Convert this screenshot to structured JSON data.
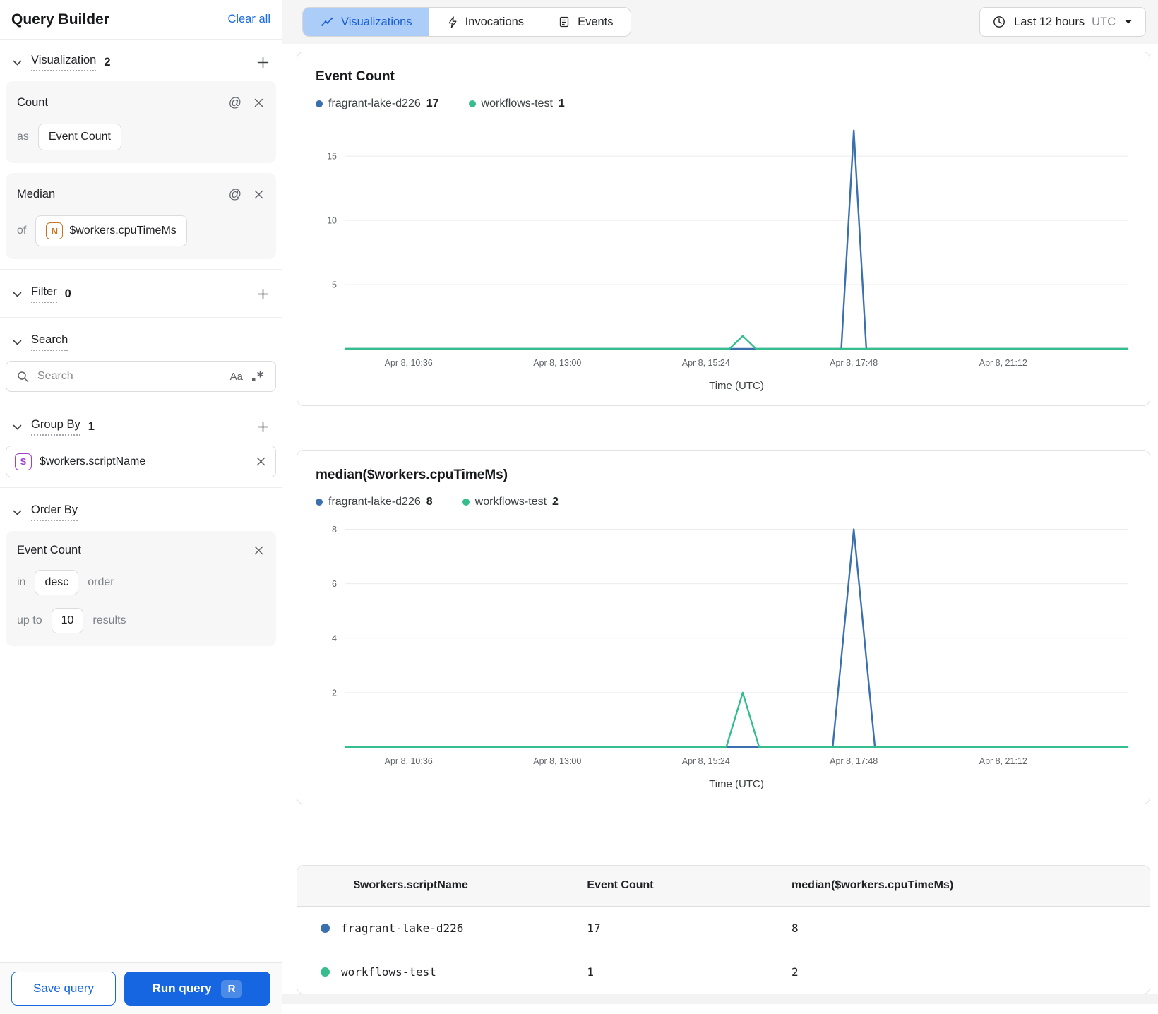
{
  "colors": {
    "accent_blue": "#1566e0",
    "link_blue": "#1a6ce0",
    "series_blue": "#3b70af",
    "series_green": "#35bd8d",
    "tab_selected_bg": "#abcdf8",
    "tab_selected_fg": "#1a5fd0"
  },
  "sidebar": {
    "title": "Query Builder",
    "clear_all_label": "Clear all",
    "visualization": {
      "label": "Visualization",
      "count": "2",
      "cards": [
        {
          "title": "Count",
          "prefix": "as",
          "value": "Event Count"
        },
        {
          "title": "Median",
          "prefix": "of",
          "field_badge": "N",
          "value": "$workers.cpuTimeMs"
        }
      ]
    },
    "filter": {
      "label": "Filter",
      "count": "0"
    },
    "search": {
      "label": "Search",
      "placeholder": "Search",
      "case_toggle": "Aa"
    },
    "group_by": {
      "label": "Group By",
      "count": "1",
      "items": [
        {
          "badge": "S",
          "value": "$workers.scriptName"
        }
      ]
    },
    "order_by": {
      "label": "Order By",
      "card": {
        "title": "Event Count",
        "in_label": "in",
        "direction": "desc",
        "order_label": "order",
        "up_to_label": "up to",
        "limit": "10",
        "results_label": "results"
      }
    },
    "footer": {
      "save_label": "Save query",
      "run_label": "Run query",
      "run_shortcut": "R"
    }
  },
  "topbar": {
    "tabs": [
      {
        "label": "Visualizations",
        "icon": "chart-line-icon",
        "selected": true
      },
      {
        "label": "Invocations",
        "icon": "bolt-icon",
        "selected": false
      },
      {
        "label": "Events",
        "icon": "events-icon",
        "selected": false
      }
    ],
    "time_range": {
      "label": "Last 12 hours",
      "timezone": "UTC"
    }
  },
  "chart_data": [
    {
      "type": "line",
      "title": "Event Count",
      "xlabel": "Time (UTC)",
      "x_ticks": [
        "Apr 8, 10:36",
        "Apr 8, 13:00",
        "Apr 8, 15:24",
        "Apr 8, 17:48",
        "Apr 8, 21:12"
      ],
      "x_tick_fracs": [
        0.081,
        0.271,
        0.461,
        0.65,
        0.841
      ],
      "y_ticks": [
        5,
        10,
        15
      ],
      "ylim": [
        0,
        17.7
      ],
      "grid": true,
      "legend_position": "top",
      "legend": [
        {
          "name": "fragrant-lake-d226",
          "value": "17",
          "color": "#3b70af"
        },
        {
          "name": "workflows-test",
          "value": "1",
          "color": "#35bd8d"
        }
      ],
      "series": [
        {
          "name": "fragrant-lake-d226",
          "color": "#3b70af",
          "points": [
            [
              0,
              0
            ],
            [
              0.634,
              0
            ],
            [
              0.65,
              17
            ],
            [
              0.666,
              0
            ],
            [
              1,
              0
            ]
          ]
        },
        {
          "name": "workflows-test",
          "color": "#35bd8d",
          "points": [
            [
              0,
              0
            ],
            [
              0.491,
              0
            ],
            [
              0.508,
              1
            ],
            [
              0.525,
              0
            ],
            [
              1,
              0
            ]
          ]
        }
      ]
    },
    {
      "type": "line",
      "title": "median($workers.cpuTimeMs)",
      "xlabel": "Time (UTC)",
      "x_ticks": [
        "Apr 8, 10:36",
        "Apr 8, 13:00",
        "Apr 8, 15:24",
        "Apr 8, 17:48",
        "Apr 8, 21:12"
      ],
      "x_tick_fracs": [
        0.081,
        0.271,
        0.461,
        0.65,
        0.841
      ],
      "y_ticks": [
        2,
        4,
        6,
        8
      ],
      "ylim": [
        0,
        8.35
      ],
      "grid": true,
      "legend_position": "top",
      "legend": [
        {
          "name": "fragrant-lake-d226",
          "value": "8",
          "color": "#3b70af"
        },
        {
          "name": "workflows-test",
          "value": "2",
          "color": "#35bd8d"
        }
      ],
      "series": [
        {
          "name": "fragrant-lake-d226",
          "color": "#3b70af",
          "points": [
            [
              0,
              0
            ],
            [
              0.623,
              0
            ],
            [
              0.65,
              8
            ],
            [
              0.677,
              0
            ],
            [
              1,
              0
            ]
          ]
        },
        {
          "name": "workflows-test",
          "color": "#35bd8d",
          "points": [
            [
              0,
              0
            ],
            [
              0.487,
              0
            ],
            [
              0.508,
              2
            ],
            [
              0.529,
              0
            ],
            [
              1,
              0
            ]
          ]
        }
      ]
    }
  ],
  "results_table": {
    "headers": [
      "$workers.scriptName",
      "Event Count",
      "median($workers.cpuTimeMs)"
    ],
    "rows": [
      {
        "color": "#3b70af",
        "cells": [
          "fragrant-lake-d226",
          "17",
          "8"
        ]
      },
      {
        "color": "#35bd8d",
        "cells": [
          "workflows-test",
          "1",
          "2"
        ]
      }
    ]
  }
}
